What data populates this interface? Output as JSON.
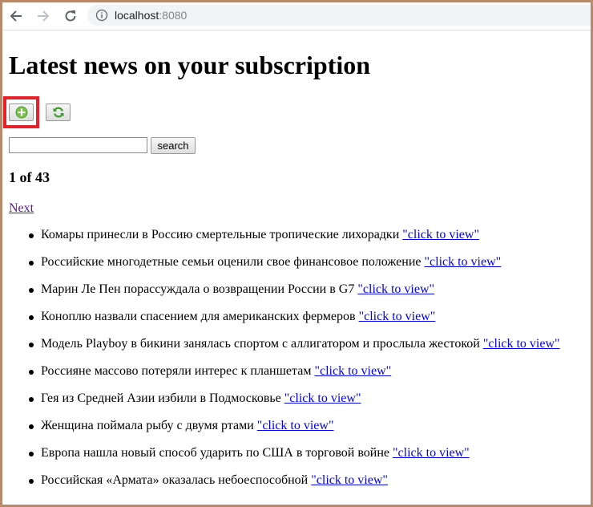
{
  "browser": {
    "url_host": "localhost",
    "url_port": ":8080"
  },
  "page": {
    "title": "Latest news on your subscription",
    "add_icon": "add-circle-icon",
    "refresh_icon": "refresh-icon",
    "search_placeholder": "",
    "search_button_label": "search",
    "pager_text": "1 of 43",
    "next_label": "Next"
  },
  "news": [
    {
      "text": "Комары принесли в Россию смертельные тропические лихорадки",
      "link": "\"click to view\""
    },
    {
      "text": "Российские многодетные семьи оценили свое финансовое положение",
      "link": "\"click to view\""
    },
    {
      "text": "Марин Ле Пен порассуждала о возвращении России в G7",
      "link": "\"click to view\""
    },
    {
      "text": "Коноплю назвали спасением для американских фермеров",
      "link": "\"click to view\""
    },
    {
      "text": "Модель Playboy в бикини занялась спортом с аллигатором и прослыла жестокой",
      "link": "\"click to view\""
    },
    {
      "text": "Россияне массово потеряли интерес к планшетам",
      "link": "\"click to view\""
    },
    {
      "text": "Гея из Средней Азии избили в Подмосковье",
      "link": "\"click to view\""
    },
    {
      "text": "Женщина поймала рыбу с двумя ртами",
      "link": "\"click to view\""
    },
    {
      "text": "Европа нашла новый способ ударить по США в торговой войне",
      "link": "\"click to view\""
    },
    {
      "text": "Российская «Армата» оказалась небоеспособной",
      "link": "\"click to view\""
    }
  ],
  "colors": {
    "highlight": "#e8202a",
    "link": "#0000ee",
    "visited_link": "#551a8b"
  }
}
